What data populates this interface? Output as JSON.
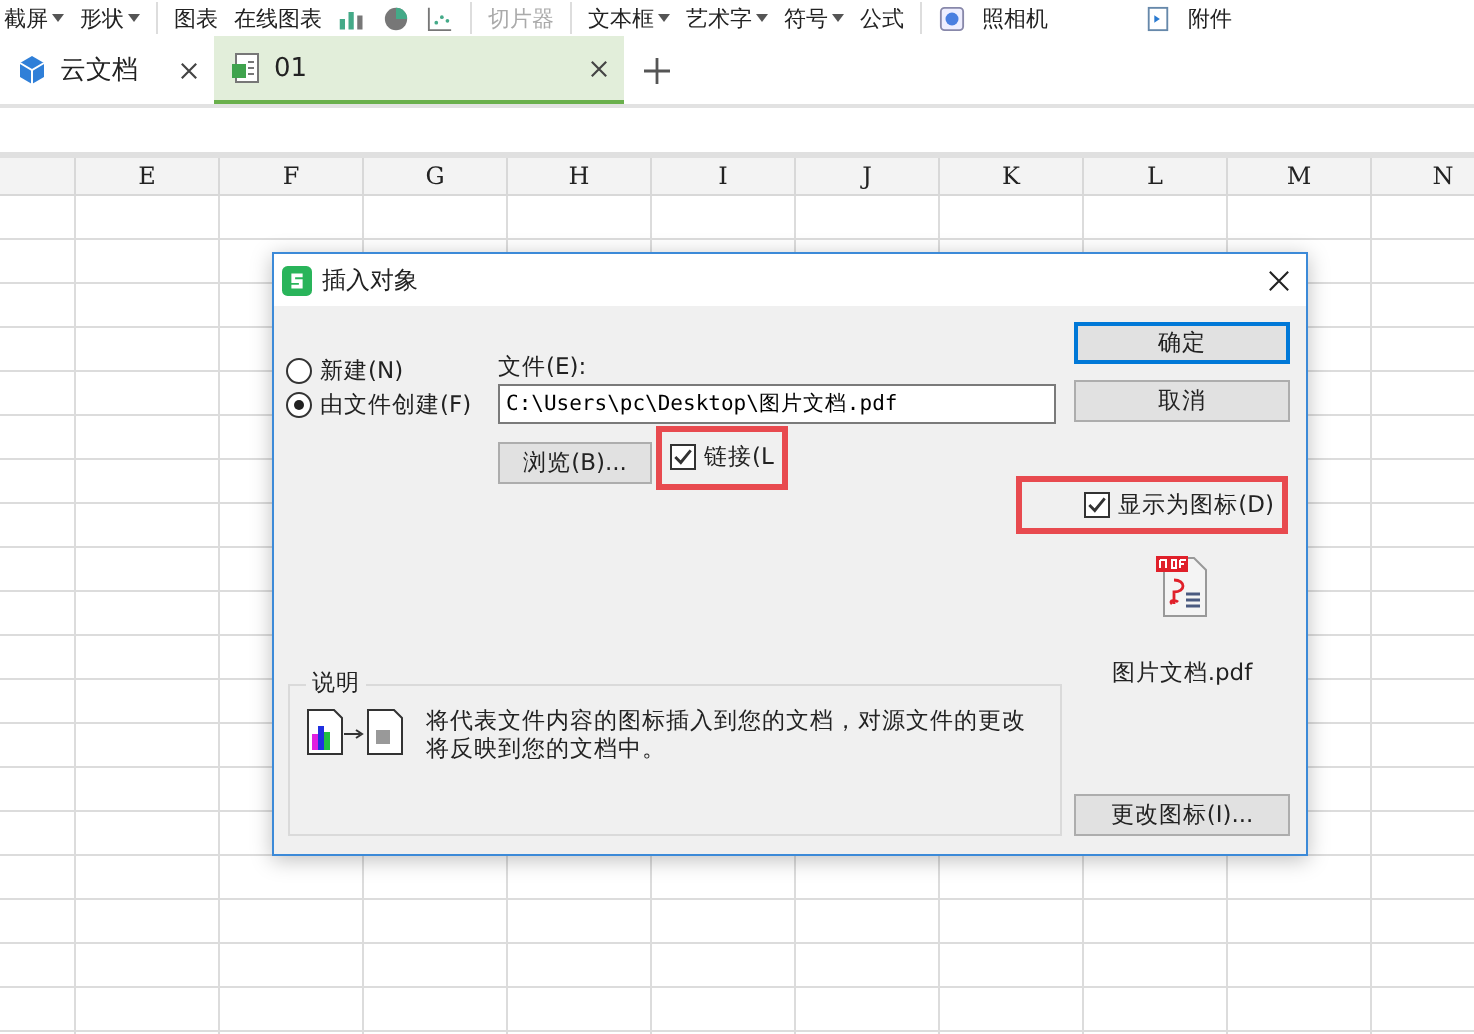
{
  "toolbar": [
    {
      "label": "截屏",
      "dropdown": true,
      "disabled": false
    },
    {
      "label": "形状",
      "dropdown": true,
      "disabled": false
    },
    {
      "label": "图表",
      "dropdown": false,
      "disabled": false
    },
    {
      "label": "在线图表",
      "dropdown": false,
      "disabled": false
    },
    {
      "label": "切片器",
      "dropdown": false,
      "disabled": true
    },
    {
      "label": "文本框",
      "dropdown": true,
      "disabled": false
    },
    {
      "label": "艺术字",
      "dropdown": true,
      "disabled": false
    },
    {
      "label": "符号",
      "dropdown": true,
      "disabled": false
    },
    {
      "label": "公式",
      "dropdown": false,
      "disabled": false
    },
    {
      "label": "照相机",
      "dropdown": false,
      "disabled": false
    },
    {
      "label": "附件",
      "dropdown": false,
      "disabled": false
    }
  ],
  "tabs": [
    {
      "label": "云文档",
      "kind": "cloud",
      "selected": false
    },
    {
      "label": "01",
      "kind": "sheet",
      "selected": true
    }
  ],
  "columns": [
    "E",
    "F",
    "G",
    "H",
    "I",
    "J",
    "K",
    "L",
    "M",
    "N"
  ],
  "dialog": {
    "title": "插入对象",
    "options": [
      {
        "label": "新建(N)",
        "selected": false
      },
      {
        "label": "由文件创建(F)",
        "selected": true
      }
    ],
    "file_label": "文件(E):",
    "file_value": "C:\\Users\\pc\\Desktop\\图片文档.pdf",
    "browse": "浏览(B)...",
    "link": {
      "label": "链接(L",
      "checked": true,
      "highlighted": true
    },
    "display_as_icon": {
      "label": "显示为图标(D)",
      "checked": true,
      "highlighted": true
    },
    "icon_caption": "图片文档.pdf",
    "ok": "确定",
    "cancel": "取消",
    "change_icon": "更改图标(I)...",
    "description": {
      "title": "说明",
      "text": "将代表文件内容的图标插入到您的文档，对源文件的更改将反映到您的文档中。"
    }
  }
}
